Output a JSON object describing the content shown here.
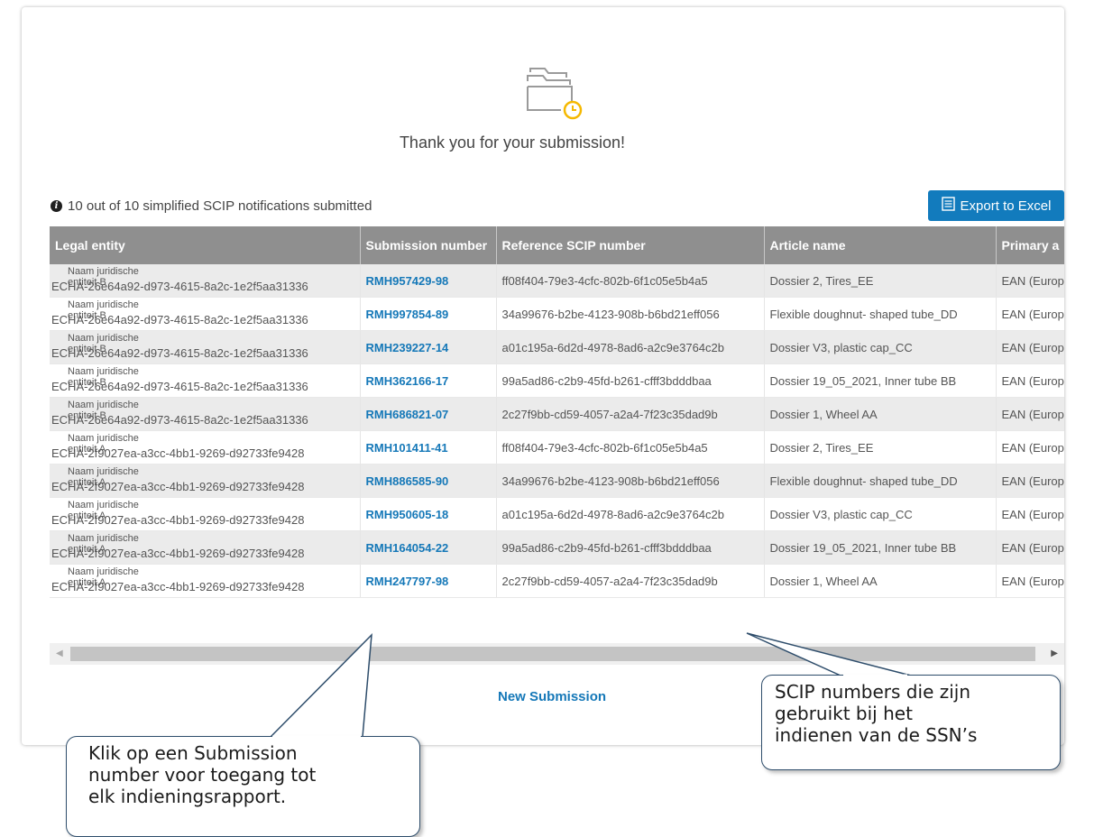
{
  "header": {
    "title": "Thank you for your submission!",
    "folder_icon": "folder-clock-icon",
    "accent_color": "#f5b800"
  },
  "summary": {
    "icon": "info-icon",
    "text": "10 out of 10 simplified SCIP notifications submitted"
  },
  "toolbar": {
    "export_label": "Export to Excel",
    "export_icon": "spreadsheet-icon",
    "button_color": "#127bbd"
  },
  "table": {
    "columns": [
      "Legal entity",
      "Submission number",
      "Reference SCIP number",
      "Article name",
      "Primary a"
    ],
    "rows": [
      {
        "legal_name": "Naam juridische entiteit B",
        "legal_id": "ECHA-26e64a92-d973-4615-8a2c-1e2f5aa31336",
        "submission": "RMH957429-98",
        "reference": "ff08f404-79e3-4cfc-802b-6f1c05e5b4a5",
        "article": "Dossier 2, Tires_EE",
        "primary": "EAN (Europ"
      },
      {
        "legal_name": "Naam juridische entiteit B",
        "legal_id": "ECHA-26e64a92-d973-4615-8a2c-1e2f5aa31336",
        "submission": "RMH997854-89",
        "reference": "34a99676-b2be-4123-908b-b6bd21eff056",
        "article": "Flexible doughnut- shaped tube_DD",
        "primary": "EAN (Europ"
      },
      {
        "legal_name": "Naam juridische entiteit B",
        "legal_id": "ECHA-26e64a92-d973-4615-8a2c-1e2f5aa31336",
        "submission": "RMH239227-14",
        "reference": "a01c195a-6d2d-4978-8ad6-a2c9e3764c2b",
        "article": "Dossier V3, plastic cap_CC",
        "primary": "EAN (Europ"
      },
      {
        "legal_name": "Naam juridische entiteit B",
        "legal_id": "ECHA-26e64a92-d973-4615-8a2c-1e2f5aa31336",
        "submission": "RMH362166-17",
        "reference": "99a5ad86-c2b9-45fd-b261-cfff3bdddbaa",
        "article": "Dossier 19_05_2021, Inner tube BB",
        "primary": "EAN (Europ"
      },
      {
        "legal_name": "Naam juridische entiteit B",
        "legal_id": "ECHA-26e64a92-d973-4615-8a2c-1e2f5aa31336",
        "submission": "RMH686821-07",
        "reference": "2c27f9bb-cd59-4057-a2a4-7f23c35dad9b",
        "article": "Dossier 1, Wheel AA",
        "primary": "EAN (Europ"
      },
      {
        "legal_name": "Naam juridische entiteit A",
        "legal_id": "ECHA-2f9027ea-a3cc-4bb1-9269-d92733fe9428",
        "submission": "RMH101411-41",
        "reference": "ff08f404-79e3-4cfc-802b-6f1c05e5b4a5",
        "article": "Dossier 2, Tires_EE",
        "primary": "EAN (Europ"
      },
      {
        "legal_name": "Naam juridische entiteit A",
        "legal_id": "ECHA-2f9027ea-a3cc-4bb1-9269-d92733fe9428",
        "submission": "RMH886585-90",
        "reference": "34a99676-b2be-4123-908b-b6bd21eff056",
        "article": "Flexible doughnut- shaped tube_DD",
        "primary": "EAN (Europ"
      },
      {
        "legal_name": "Naam juridische entiteit A",
        "legal_id": "ECHA-2f9027ea-a3cc-4bb1-9269-d92733fe9428",
        "submission": "RMH950605-18",
        "reference": "a01c195a-6d2d-4978-8ad6-a2c9e3764c2b",
        "article": "Dossier V3, plastic cap_CC",
        "primary": "EAN (Europ"
      },
      {
        "legal_name": "Naam juridische entiteit A",
        "legal_id": "ECHA-2f9027ea-a3cc-4bb1-9269-d92733fe9428",
        "submission": "RMH164054-22",
        "reference": "99a5ad86-c2b9-45fd-b261-cfff3bdddbaa",
        "article": "Dossier 19_05_2021, Inner tube BB",
        "primary": "EAN (Europ"
      },
      {
        "legal_name": "Naam juridische entiteit A",
        "legal_id": "ECHA-2f9027ea-a3cc-4bb1-9269-d92733fe9428",
        "submission": "RMH247797-98",
        "reference": "2c27f9bb-cd59-4057-a2a4-7f23c35dad9b",
        "article": "Dossier 1, Wheel AA",
        "primary": "EAN (Europ"
      }
    ]
  },
  "scrollbar": {
    "left_icon": "scroll-left-arrow-icon",
    "right_icon": "scroll-right-arrow-icon"
  },
  "actions": {
    "new_submission": "New Submission"
  },
  "callouts": {
    "left": "Klik op een Submission\nnumber voor toegang tot\nelk indieningsrapport.",
    "right": "SCIP numbers die zijn\ngebruikt bij het\nindienen van de SSN’s"
  }
}
